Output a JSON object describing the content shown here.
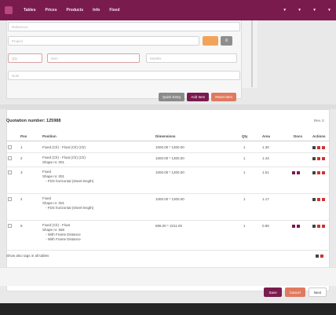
{
  "topbar": {
    "nav": [
      "Tables",
      "Prices",
      "Products",
      "Info",
      "Fixed"
    ],
    "right": [
      "▼",
      "▼",
      "▼",
      "▼"
    ]
  },
  "form": {
    "fields": [
      {
        "placeholder": "Reference"
      },
      {
        "placeholder": "Project"
      },
      {
        "placeholder": "Qty"
      },
      {
        "placeholder": "Item"
      },
      {
        "placeholder": "Models"
      },
      {
        "placeholder": "Note"
      }
    ]
  },
  "actions": {
    "quick_entry": "Quick Entry",
    "add_item": "Add Item",
    "reset": "Reset Item"
  },
  "quotation": {
    "title": "Quotation number: 125988",
    "rev": "Rev. 0"
  },
  "table": {
    "headers": [
      "Pos",
      "Position",
      "Dimensions",
      "Qty",
      "Area",
      "Docs",
      "Actions"
    ],
    "rows": [
      {
        "pos": "1",
        "position": [
          "Fixed (Clr) - Float (Clr) (Clr)"
        ],
        "dimensions": "1000.00 * 1300.00",
        "qty": "1",
        "area": "1.30"
      },
      {
        "pos": "2",
        "position": [
          "Fixed (Clr) - Float (Clr) (Clr)",
          "Shape nr. 001"
        ],
        "dimensions": "1000.00 * 1300.00",
        "qty": "1",
        "area": "1.43"
      },
      {
        "pos": "3",
        "position": [
          "Fixed",
          "Shape nr. 001",
          "- FDS horizontal (sheet length)"
        ],
        "dimensions": "1000.00 * 1300.00",
        "qty": "1",
        "area": "1.51"
      },
      {
        "pos": "4",
        "position": [
          "Fixed",
          "Shape nr. 001",
          "- FDS horizontal (sheet length)"
        ],
        "dimensions": "1000.00 * 1300.00",
        "qty": "1",
        "area": "1.17"
      },
      {
        "pos": "5",
        "position": [
          "Fixed (Clr) - Float",
          "Shape nr. 558",
          "- With Frame Distance",
          "- With Frame Distance"
        ],
        "dimensions": "895.00 * 1011.00",
        "qty": "1",
        "area": "0.89"
      }
    ]
  },
  "footnote": "Show also tags in all tables",
  "footer": {
    "save": "Save",
    "cancel": "Cancel",
    "next": "Next"
  }
}
